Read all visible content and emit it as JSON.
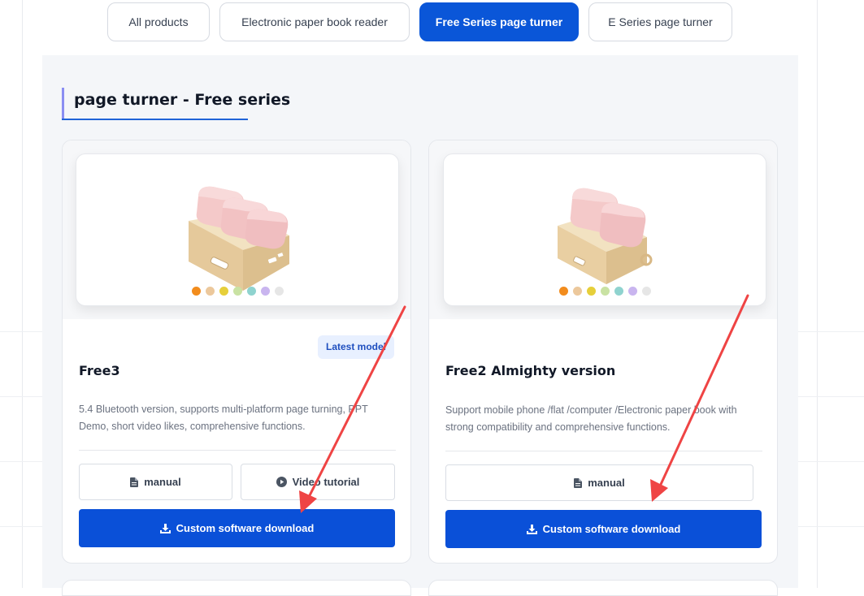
{
  "tabs": [
    {
      "label": "All products",
      "active": false
    },
    {
      "label": "Electronic paper book reader",
      "active": false
    },
    {
      "label": "Free Series page turner",
      "active": true
    },
    {
      "label": "E Series page turner",
      "active": false
    }
  ],
  "section": {
    "title": "page turner - Free series"
  },
  "colors": {
    "accent": "#0a50d8",
    "arrow": "#ef4444",
    "section_bar": "#8a8ef2"
  },
  "cards": [
    {
      "name": "Free3",
      "badge": "Latest model",
      "description": "5.4 Bluetooth version, supports multi-platform page turning, PPT Demo, short video likes, comprehensive functions.",
      "manual_label": "manual",
      "video_label": "Video tutorial",
      "download_label": "Custom software download",
      "color_dots": [
        "#f28c1d",
        "#ecc89c",
        "#e6cf3a",
        "#c9e2a3",
        "#8fd3cf",
        "#c9b5ef",
        "#e6e6e6"
      ]
    },
    {
      "name": "Free2 Almighty version",
      "description": "Support mobile phone /flat /computer /Electronic paper book with strong compatibility and comprehensive functions.",
      "manual_label": "manual",
      "download_label": "Custom software download",
      "color_dots": [
        "#f28c1d",
        "#ecc89c",
        "#e6cf3a",
        "#c9e2a3",
        "#8fd3cf",
        "#c9b5ef",
        "#e6e6e6"
      ]
    }
  ]
}
